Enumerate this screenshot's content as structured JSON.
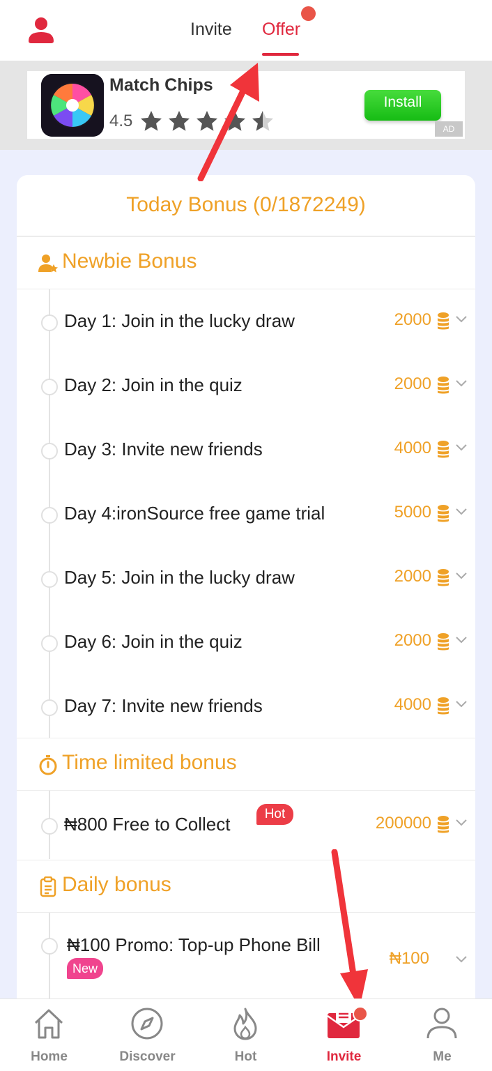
{
  "header": {
    "tabs": [
      {
        "label": "Invite",
        "active": false
      },
      {
        "label": "Offer",
        "active": true
      }
    ],
    "accent_color": "#e0283e"
  },
  "ad": {
    "title": "Match Chips",
    "rating": "4.5",
    "stars": 4.5,
    "install_label": "Install",
    "badge_label": "AD"
  },
  "bonus": {
    "title": "Today Bonus (0/1872249)",
    "accent_color": "#efa127",
    "sections": [
      {
        "title": "Newbie Bonus",
        "icon": "user-star-icon",
        "tasks": [
          {
            "label": "Day 1: Join in the lucky draw",
            "amount": "2000"
          },
          {
            "label": "Day 2: Join in the quiz",
            "amount": "2000"
          },
          {
            "label": "Day 3: Invite new friends",
            "amount": "4000"
          },
          {
            "label": "Day 4:ironSource free game trial",
            "amount": "5000"
          },
          {
            "label": "Day 5: Join in the lucky draw",
            "amount": "2000"
          },
          {
            "label": "Day 6: Join in the quiz",
            "amount": "2000"
          },
          {
            "label": "Day 7: Invite new friends",
            "amount": "4000"
          }
        ]
      },
      {
        "title": "Time limited bonus",
        "icon": "stopwatch-icon",
        "tasks": [
          {
            "label": "₦800 Free to Collect",
            "amount": "200000",
            "badge": "Hot"
          }
        ]
      },
      {
        "title": "Daily bonus",
        "icon": "clipboard-icon",
        "tasks": [
          {
            "label": "₦100 Promo: Top-up Phone Bill",
            "amount": "₦100",
            "badge": "New"
          }
        ]
      }
    ]
  },
  "nav": {
    "items": [
      {
        "label": "Home",
        "icon": "home-icon",
        "active": false
      },
      {
        "label": "Discover",
        "icon": "compass-icon",
        "active": false
      },
      {
        "label": "Hot",
        "icon": "flame-icon",
        "active": false
      },
      {
        "label": "Invite",
        "icon": "envelope-icon",
        "active": true
      },
      {
        "label": "Me",
        "icon": "person-icon",
        "active": false
      }
    ]
  }
}
